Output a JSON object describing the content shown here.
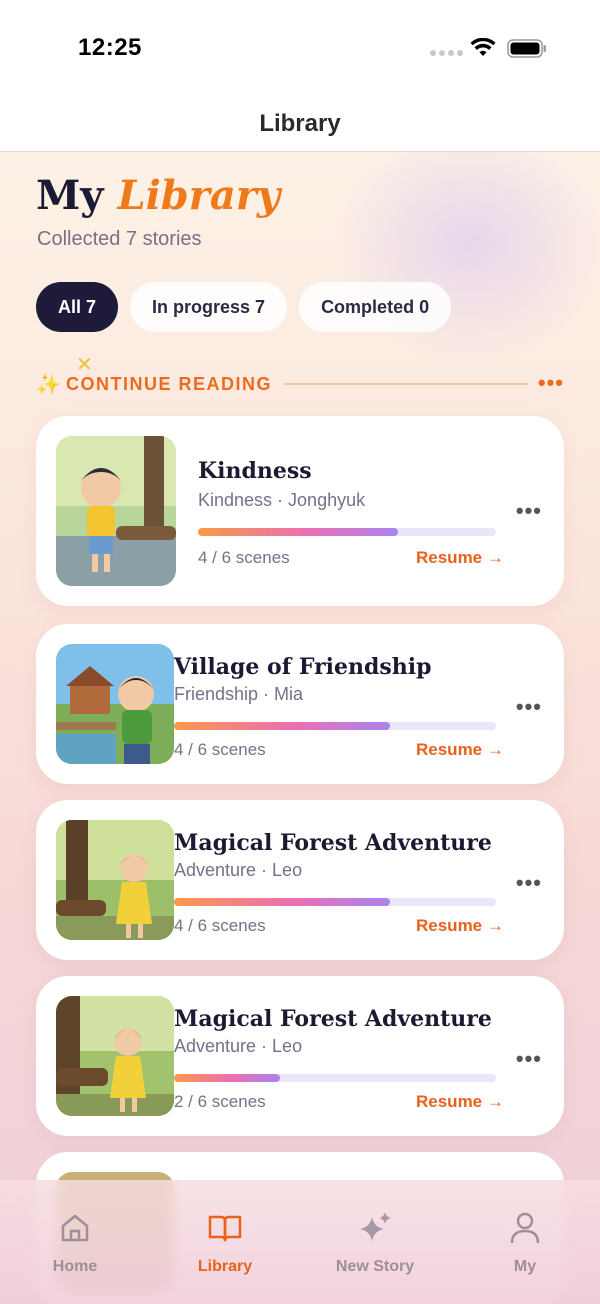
{
  "status_bar": {
    "time": "12:25"
  },
  "header": {
    "title": "Library"
  },
  "page": {
    "heading_prefix": "My",
    "heading_accent": "Library",
    "subtitle": "Collected 7 stories"
  },
  "filters": [
    {
      "label": "All 7",
      "active": true
    },
    {
      "label": "In progress 7",
      "active": false
    },
    {
      "label": "Completed 0",
      "active": false
    }
  ],
  "section": {
    "label": "CONTINUE READING",
    "more": "•••"
  },
  "stories": [
    {
      "title": "Kindness",
      "meta": "Kindness · Jonghyuk",
      "progress": 0.67,
      "scenes": "4 / 6 scenes",
      "resume": "Resume →"
    },
    {
      "title": "Village of Friendship",
      "meta": "Friendship · Mia",
      "progress": 0.67,
      "scenes": "4 / 6 scenes",
      "resume": "Resume →"
    },
    {
      "title": "Magical Forest Adventure",
      "meta": "Adventure · Leo",
      "progress": 0.67,
      "scenes": "4 / 6 scenes",
      "resume": "Resume →"
    },
    {
      "title": "Magical Forest Adventure",
      "meta": "Adventure · Leo",
      "progress": 0.33,
      "scenes": "2 / 6 scenes",
      "resume": "Resume →"
    }
  ],
  "tab_bar": [
    {
      "label": "Home",
      "icon": "home-icon",
      "active": false
    },
    {
      "label": "Library",
      "icon": "book-icon",
      "active": true
    },
    {
      "label": "New Story",
      "icon": "sparkle-icon",
      "active": false
    },
    {
      "label": "My",
      "icon": "person-icon",
      "active": false
    }
  ],
  "colors": {
    "accent": "#e9621c",
    "dark": "#1e1b3a"
  }
}
